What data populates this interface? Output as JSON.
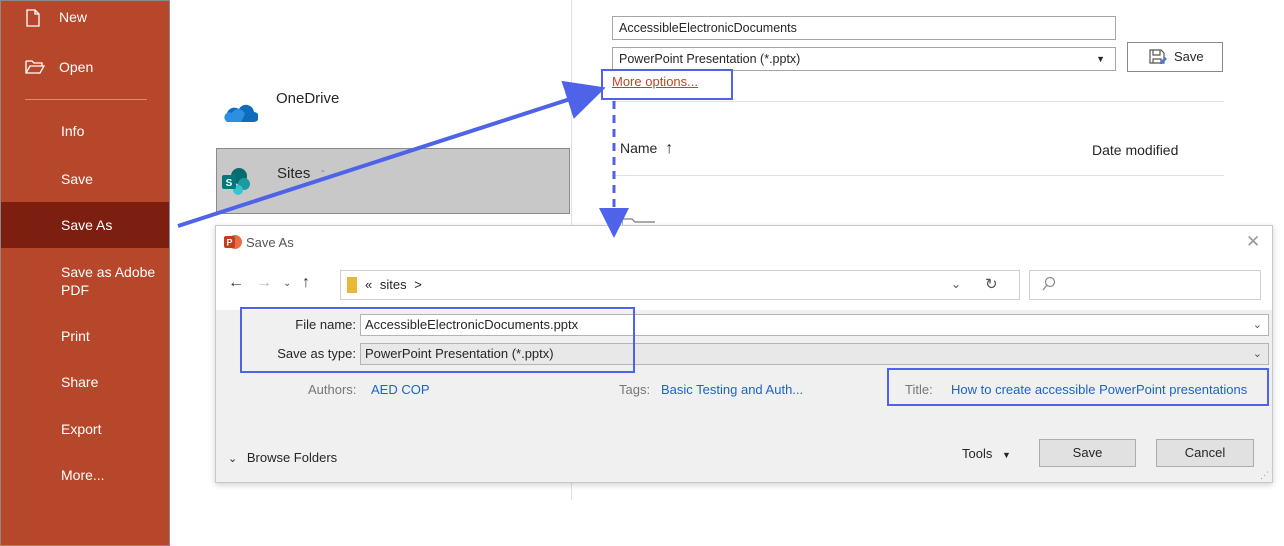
{
  "nav": {
    "items": [
      {
        "label": "New",
        "icon": "new-document-icon"
      },
      {
        "label": "Open",
        "icon": "folder-open-icon"
      },
      {
        "label": "Info"
      },
      {
        "label": "Save"
      },
      {
        "label": "Save As",
        "selected": true
      },
      {
        "label": "Save as Adobe PDF"
      },
      {
        "label": "Print"
      },
      {
        "label": "Share"
      },
      {
        "label": "Export"
      },
      {
        "label": "More..."
      }
    ]
  },
  "locations": {
    "onedrive": "OneDrive",
    "sites": "Sites",
    "sites_suffix": "-"
  },
  "backstage": {
    "filename": "AccessibleElectronicDocuments",
    "filetype": "PowerPoint Presentation (*.pptx)",
    "save_label": "Save",
    "more_options": "More options...",
    "col_name": "Name",
    "col_date": "Date modified"
  },
  "dialog": {
    "title": "Save As",
    "path_prefix": "«",
    "path_folder": "sites",
    "path_chevron": ">",
    "file_name_label": "File name:",
    "file_name": "AccessibleElectronicDocuments.pptx",
    "save_type_label": "Save as type:",
    "save_type": "PowerPoint Presentation (*.pptx)",
    "authors_label": "Authors:",
    "authors": "AED COP",
    "tags_label": "Tags:",
    "tags": "Basic Testing and Auth...",
    "title_label": "Title:",
    "title_value": "How to create accessible PowerPoint presentations",
    "browse_folders": "Browse Folders",
    "tools": "Tools",
    "save": "Save",
    "cancel": "Cancel"
  },
  "colors": {
    "accent": "#b7472a",
    "nav_selected": "#7d1f10",
    "highlight": "#4f63e8",
    "link": "#1d63c6"
  }
}
